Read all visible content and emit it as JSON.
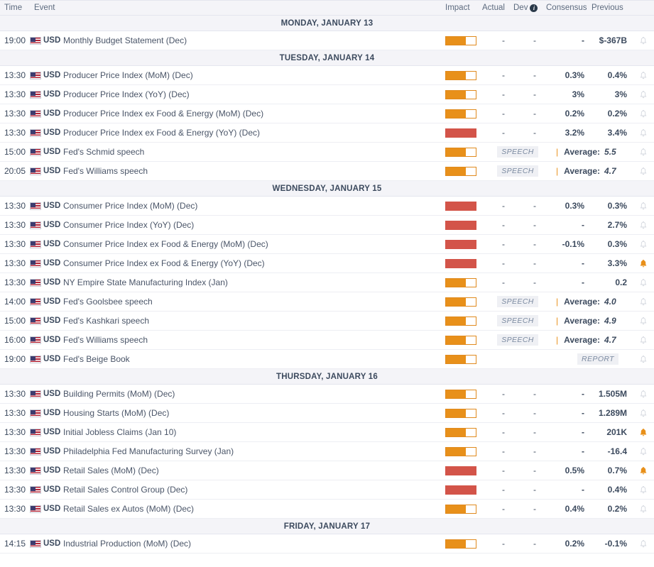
{
  "header": {
    "time": "Time",
    "event": "Event",
    "impact": "Impact",
    "actual": "Actual",
    "dev": "Dev",
    "info_icon": "info-icon",
    "consensus": "Consensus",
    "previous": "Previous"
  },
  "colors": {
    "impact_medium": "#e8901a",
    "impact_high": "#d35449",
    "bell_active": "#e8901a",
    "bell_inactive": "#cfd3db",
    "day_header_bg": "#f4f4f8",
    "text": "#3c4a5e"
  },
  "days": [
    {
      "label": "MONDAY, JANUARY 13",
      "rows": [
        {
          "time": "19:00",
          "currency": "USD",
          "flag": "us-flag-icon",
          "event": "Monthly Budget Statement (Dec)",
          "impact": "medium",
          "actual": "-",
          "dev": "-",
          "consensus": "-",
          "previous": "$-367B",
          "bell": "off"
        }
      ]
    },
    {
      "label": "TUESDAY, JANUARY 14",
      "rows": [
        {
          "time": "13:30",
          "currency": "USD",
          "flag": "us-flag-icon",
          "event": "Producer Price Index (MoM) (Dec)",
          "impact": "medium",
          "actual": "-",
          "dev": "-",
          "consensus": "0.3%",
          "previous": "0.4%",
          "bell": "off"
        },
        {
          "time": "13:30",
          "currency": "USD",
          "flag": "us-flag-icon",
          "event": "Producer Price Index (YoY) (Dec)",
          "impact": "medium",
          "actual": "-",
          "dev": "-",
          "consensus": "3%",
          "previous": "3%",
          "bell": "off"
        },
        {
          "time": "13:30",
          "currency": "USD",
          "flag": "us-flag-icon",
          "event": "Producer Price Index ex Food & Energy (MoM) (Dec)",
          "impact": "medium",
          "actual": "-",
          "dev": "-",
          "consensus": "0.2%",
          "previous": "0.2%",
          "bell": "off"
        },
        {
          "time": "13:30",
          "currency": "USD",
          "flag": "us-flag-icon",
          "event": "Producer Price Index ex Food & Energy (YoY) (Dec)",
          "impact": "high",
          "actual": "-",
          "dev": "-",
          "consensus": "3.2%",
          "previous": "3.4%",
          "bell": "off"
        },
        {
          "time": "15:00",
          "currency": "USD",
          "flag": "us-flag-icon",
          "event": "Fed's Schmid speech",
          "impact": "medium",
          "type": "speech",
          "badge": "SPEECH",
          "avg_label": "Average:",
          "avg_value": "5.5",
          "bell": "off"
        },
        {
          "time": "20:05",
          "currency": "USD",
          "flag": "us-flag-icon",
          "event": "Fed's Williams speech",
          "impact": "medium",
          "type": "speech",
          "badge": "SPEECH",
          "avg_label": "Average:",
          "avg_value": "4.7",
          "bell": "off"
        }
      ]
    },
    {
      "label": "WEDNESDAY, JANUARY 15",
      "rows": [
        {
          "time": "13:30",
          "currency": "USD",
          "flag": "us-flag-icon",
          "event": "Consumer Price Index (MoM) (Dec)",
          "impact": "high",
          "actual": "-",
          "dev": "-",
          "consensus": "0.3%",
          "previous": "0.3%",
          "bell": "off"
        },
        {
          "time": "13:30",
          "currency": "USD",
          "flag": "us-flag-icon",
          "event": "Consumer Price Index (YoY) (Dec)",
          "impact": "high",
          "actual": "-",
          "dev": "-",
          "consensus": "-",
          "previous": "2.7%",
          "bell": "off"
        },
        {
          "time": "13:30",
          "currency": "USD",
          "flag": "us-flag-icon",
          "event": "Consumer Price Index ex Food & Energy (MoM) (Dec)",
          "impact": "high",
          "actual": "-",
          "dev": "-",
          "consensus": "-0.1%",
          "previous": "0.3%",
          "bell": "off"
        },
        {
          "time": "13:30",
          "currency": "USD",
          "flag": "us-flag-icon",
          "event": "Consumer Price Index ex Food & Energy (YoY) (Dec)",
          "impact": "high",
          "actual": "-",
          "dev": "-",
          "consensus": "-",
          "previous": "3.3%",
          "bell": "on"
        },
        {
          "time": "13:30",
          "currency": "USD",
          "flag": "us-flag-icon",
          "event": "NY Empire State Manufacturing Index (Jan)",
          "impact": "medium",
          "actual": "-",
          "dev": "-",
          "consensus": "-",
          "previous": "0.2",
          "bell": "off"
        },
        {
          "time": "14:00",
          "currency": "USD",
          "flag": "us-flag-icon",
          "event": "Fed's Goolsbee speech",
          "impact": "medium",
          "type": "speech",
          "badge": "SPEECH",
          "avg_label": "Average:",
          "avg_value": "4.0",
          "bell": "off"
        },
        {
          "time": "15:00",
          "currency": "USD",
          "flag": "us-flag-icon",
          "event": "Fed's Kashkari speech",
          "impact": "medium",
          "type": "speech",
          "badge": "SPEECH",
          "avg_label": "Average:",
          "avg_value": "4.9",
          "bell": "off"
        },
        {
          "time": "16:00",
          "currency": "USD",
          "flag": "us-flag-icon",
          "event": "Fed's Williams speech",
          "impact": "medium",
          "type": "speech",
          "badge": "SPEECH",
          "avg_label": "Average:",
          "avg_value": "4.7",
          "bell": "off"
        },
        {
          "time": "19:00",
          "currency": "USD",
          "flag": "us-flag-icon",
          "event": "Fed's Beige Book",
          "impact": "medium",
          "type": "report",
          "badge": "REPORT",
          "bell": "off"
        }
      ]
    },
    {
      "label": "THURSDAY, JANUARY 16",
      "rows": [
        {
          "time": "13:30",
          "currency": "USD",
          "flag": "us-flag-icon",
          "event": "Building Permits (MoM) (Dec)",
          "impact": "medium",
          "actual": "-",
          "dev": "-",
          "consensus": "-",
          "previous": "1.505M",
          "bell": "off"
        },
        {
          "time": "13:30",
          "currency": "USD",
          "flag": "us-flag-icon",
          "event": "Housing Starts (MoM) (Dec)",
          "impact": "medium",
          "actual": "-",
          "dev": "-",
          "consensus": "-",
          "previous": "1.289M",
          "bell": "off"
        },
        {
          "time": "13:30",
          "currency": "USD",
          "flag": "us-flag-icon",
          "event": "Initial Jobless Claims (Jan 10)",
          "impact": "medium",
          "actual": "-",
          "dev": "-",
          "consensus": "-",
          "previous": "201K",
          "bell": "on"
        },
        {
          "time": "13:30",
          "currency": "USD",
          "flag": "us-flag-icon",
          "event": "Philadelphia Fed Manufacturing Survey (Jan)",
          "impact": "medium",
          "actual": "-",
          "dev": "-",
          "consensus": "-",
          "previous": "-16.4",
          "bell": "off"
        },
        {
          "time": "13:30",
          "currency": "USD",
          "flag": "us-flag-icon",
          "event": "Retail Sales (MoM) (Dec)",
          "impact": "high",
          "actual": "-",
          "dev": "-",
          "consensus": "0.5%",
          "previous": "0.7%",
          "bell": "on"
        },
        {
          "time": "13:30",
          "currency": "USD",
          "flag": "us-flag-icon",
          "event": "Retail Sales Control Group (Dec)",
          "impact": "high",
          "actual": "-",
          "dev": "-",
          "consensus": "-",
          "previous": "0.4%",
          "bell": "off"
        },
        {
          "time": "13:30",
          "currency": "USD",
          "flag": "us-flag-icon",
          "event": "Retail Sales ex Autos (MoM) (Dec)",
          "impact": "medium",
          "actual": "-",
          "dev": "-",
          "consensus": "0.4%",
          "previous": "0.2%",
          "bell": "off"
        }
      ]
    },
    {
      "label": "FRIDAY, JANUARY 17",
      "rows": [
        {
          "time": "14:15",
          "currency": "USD",
          "flag": "us-flag-icon",
          "event": "Industrial Production (MoM) (Dec)",
          "impact": "medium",
          "actual": "-",
          "dev": "-",
          "consensus": "0.2%",
          "previous": "-0.1%",
          "bell": "off"
        }
      ]
    }
  ]
}
